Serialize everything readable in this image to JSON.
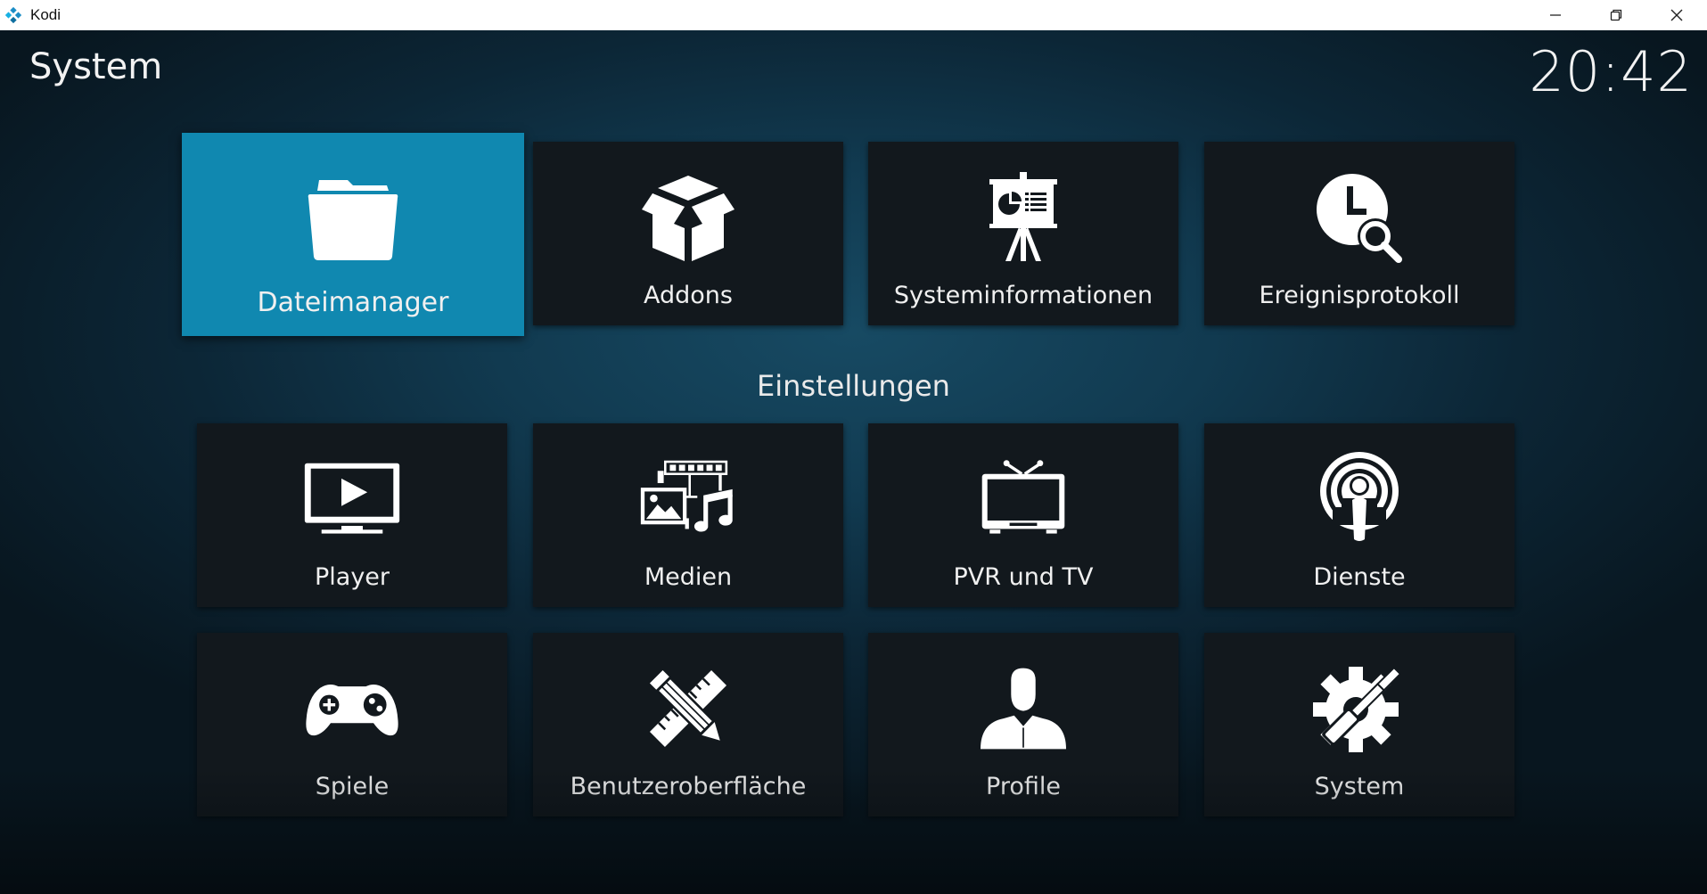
{
  "window": {
    "title": "Kodi"
  },
  "header": {
    "title": "System",
    "clock": "20:42"
  },
  "top_row": [
    {
      "label": "Dateimanager",
      "icon": "folder-icon",
      "focused": true
    },
    {
      "label": "Addons",
      "icon": "box-icon"
    },
    {
      "label": "Systeminformationen",
      "icon": "presentation-icon"
    },
    {
      "label": "Ereignisprotokoll",
      "icon": "clock-search-icon"
    }
  ],
  "settings": {
    "title": "Einstellungen",
    "items": [
      {
        "label": "Player",
        "icon": "monitor-play-icon"
      },
      {
        "label": "Medien",
        "icon": "media-icon"
      },
      {
        "label": "PVR und TV",
        "icon": "tv-icon"
      },
      {
        "label": "Dienste",
        "icon": "podcast-icon"
      },
      {
        "label": "Spiele",
        "icon": "gamepad-icon"
      },
      {
        "label": "Benutzeroberfläche",
        "icon": "pencil-ruler-icon"
      },
      {
        "label": "Profile",
        "icon": "user-icon"
      },
      {
        "label": "System",
        "icon": "gear-wrench-icon"
      }
    ]
  },
  "colors": {
    "focus": "#1088b0",
    "tile": "#12181d",
    "text": "#f0f0f0"
  }
}
